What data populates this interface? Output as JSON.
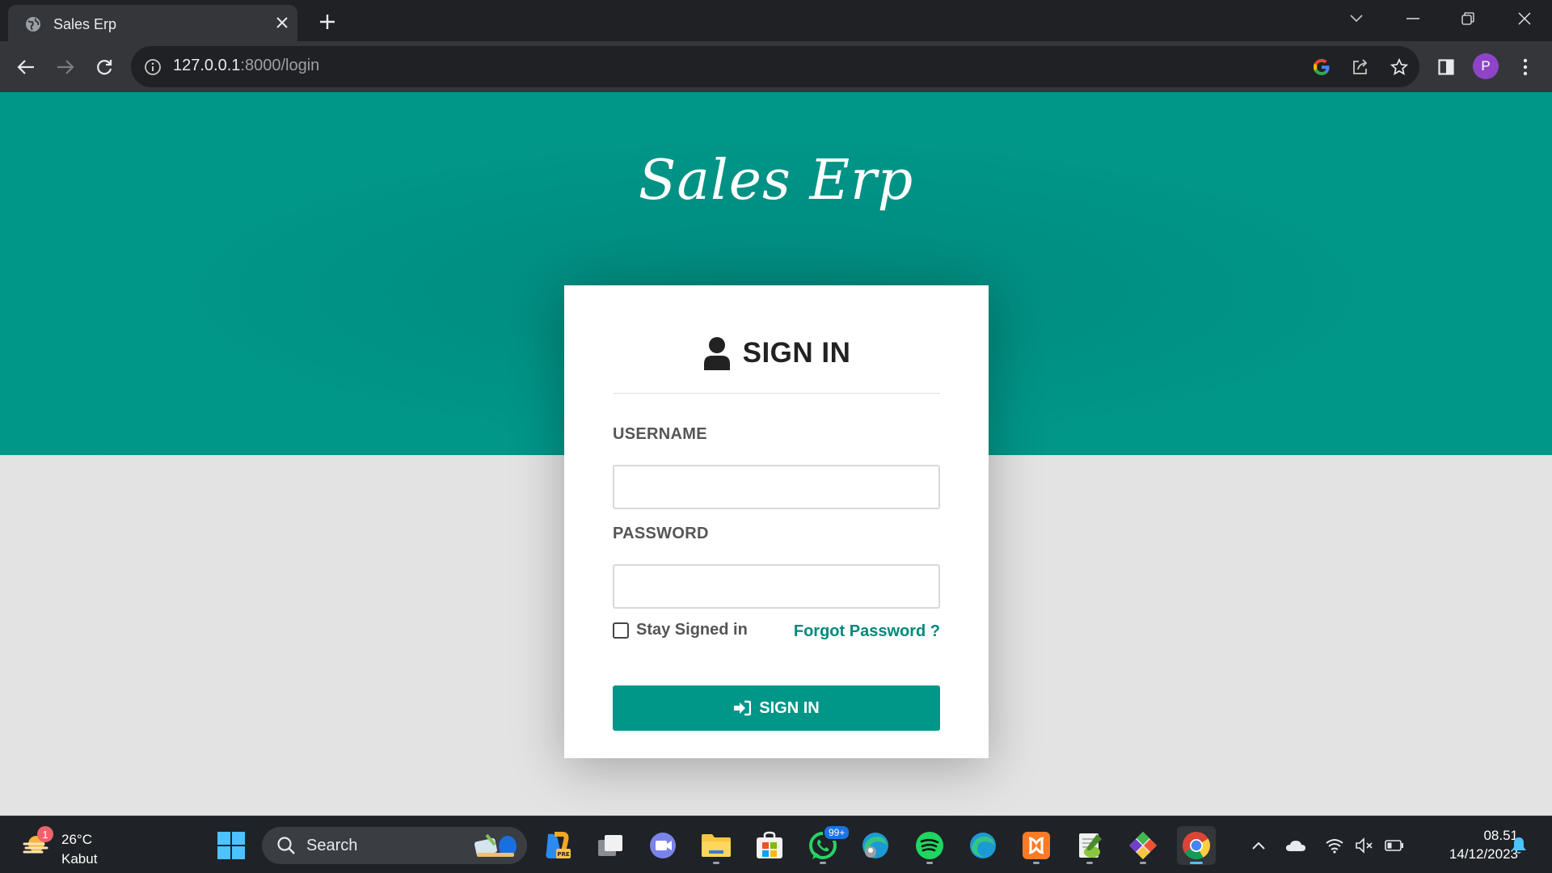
{
  "browser": {
    "tab_title": "Sales Erp",
    "url_host": "127.0.0.1",
    "url_rest": ":8000/login",
    "avatar_letter": "P"
  },
  "page": {
    "brand": "Sales Erp",
    "card_title": "SIGN IN",
    "username_label": "USERNAME",
    "username_value": "",
    "password_label": "PASSWORD",
    "password_value": "",
    "stay_signed_in_label": "Stay Signed in",
    "stay_signed_in_checked": false,
    "forgot_password": "Forgot Password ?",
    "submit_label": "SIGN IN",
    "accent_color": "#009688"
  },
  "taskbar": {
    "weather_temp": "26°C",
    "weather_condition": "Kabut",
    "weather_badge": "1",
    "search_label": "Search",
    "whatsapp_badge": "99+",
    "time": "08.51",
    "date": "14/12/2023"
  }
}
